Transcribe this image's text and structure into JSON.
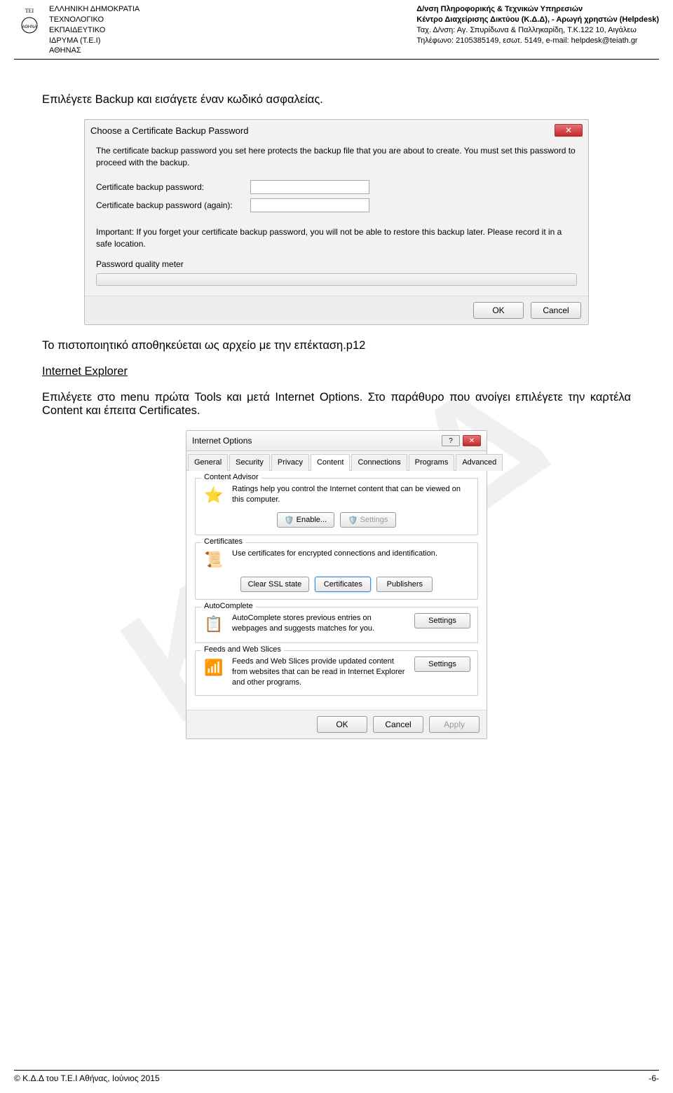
{
  "watermark": "Κ.Δ.Δ",
  "header": {
    "left": {
      "l1": "ΕΛΛΗΝΙΚΗ ΔΗΜΟΚΡΑΤΙΑ",
      "l2": "ΤΕΧΝΟΛΟΓΙΚΟ",
      "l3": "ΕΚΠΑΙΔΕΥΤΙΚΟ",
      "l4": "ΙΔΡΥΜΑ (Τ.Ε.Ι)",
      "l5": "ΑΘΗΝΑΣ"
    },
    "right": {
      "l1": "Δ/νση Πληροφορικής & Τεχνικών Υπηρεσιών",
      "l2": "Κέντρο Διαχείρισης Δικτύου (Κ.Δ.Δ), - Αρωγή χρηστών (Helpdesk)",
      "l3": "Ταχ. Δ/νση: Αγ. Σπυρίδωνα & Παλληκαρίδη, Τ.Κ.122 10, Αιγάλεω",
      "l4": "Τηλέφωνο: 2105385149, εσωτ. 5149,  e-mail: helpdesk@teiath.gr"
    }
  },
  "body": {
    "p1": "Επιλέγετε Backup και εισάγετε έναν κωδικό ασφαλείας.",
    "p2": "Το πιστοποιητικό αποθηκεύεται ως αρχείο με την επέκταση.p12",
    "ie_heading": "Internet Explorer",
    "p3": "Επιλέγετε στο menu πρώτα Tools και μετά Internet Options. Στο παράθυρο που ανοίγει επιλέγετε την καρτέλα Content και έπειτα Certificates."
  },
  "dialog1": {
    "title": "Choose a Certificate Backup Password",
    "desc": "The certificate backup password you set here protects the backup file that you are about to create. You must set this password to proceed with the backup.",
    "label_pw": "Certificate backup password:",
    "label_pw2": "Certificate backup password (again):",
    "important": "Important: If you forget your certificate backup password, you will not be able to restore this backup later. Please record it in a safe location.",
    "meter_label": "Password quality meter",
    "ok": "OK",
    "cancel": "Cancel"
  },
  "dialog2": {
    "title": "Internet Options",
    "tabs": [
      "General",
      "Security",
      "Privacy",
      "Content",
      "Connections",
      "Programs",
      "Advanced"
    ],
    "active_tab": "Content",
    "content_advisor": {
      "legend": "Content Advisor",
      "text": "Ratings help you control the Internet content that can be viewed on this computer.",
      "enable": "Enable...",
      "settings": "Settings"
    },
    "certificates": {
      "legend": "Certificates",
      "text": "Use certificates for encrypted connections and identification.",
      "clear": "Clear SSL state",
      "certs": "Certificates",
      "publishers": "Publishers"
    },
    "autocomplete": {
      "legend": "AutoComplete",
      "text": "AutoComplete stores previous entries on webpages and suggests matches for you.",
      "settings": "Settings"
    },
    "feeds": {
      "legend": "Feeds and Web Slices",
      "text": "Feeds and Web Slices provide updated content from websites that can be read in Internet Explorer and other programs.",
      "settings": "Settings"
    },
    "ok": "OK",
    "cancel": "Cancel",
    "apply": "Apply"
  },
  "footer": {
    "left": "© Κ.Δ.Δ του Τ.Ε.Ι Αθήνας, Ιούνιος 2015",
    "right": "-6-"
  }
}
